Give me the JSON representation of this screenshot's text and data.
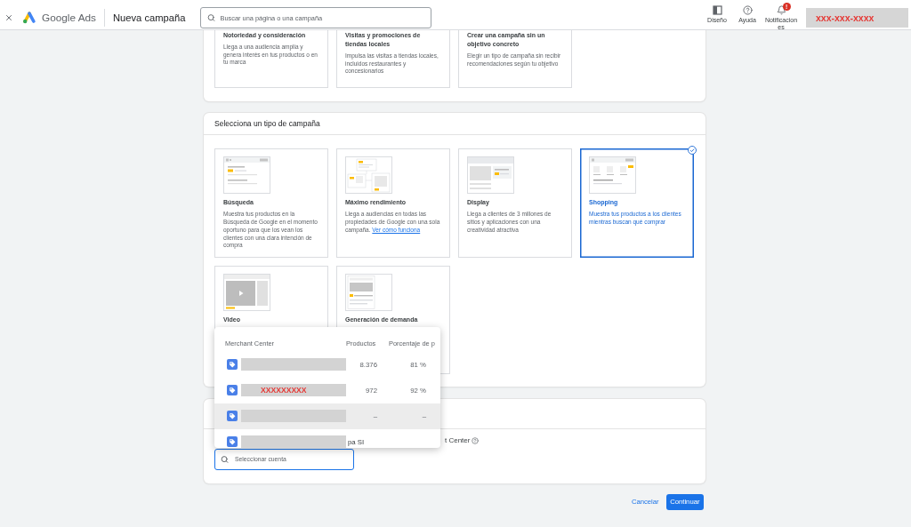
{
  "top_bar": {
    "product_name": "Google Ads",
    "page_title": "Nueva campaña",
    "search": {
      "placeholder": "Buscar una página o una campaña"
    },
    "actions": [
      {
        "kind": "appearance",
        "label": "Diseño"
      },
      {
        "kind": "help",
        "label": "Ayuda"
      },
      {
        "kind": "notifications",
        "label": "Notificaciones",
        "badge": "!"
      }
    ],
    "account": "xxx-xxx-xxxx"
  },
  "objectives": [
    {
      "title": "Notoriedad y consideración",
      "description": "Llega a una audiencia amplia y genera interés en tus productos o en tu marca",
      "selected": false
    },
    {
      "title": "Visitas y promociones de tiendas locales",
      "description": "Impulsa las visitas a tiendas locales, incluidos restaurantes y concesionarios",
      "selected": false
    },
    {
      "title": "Crear una campaña sin un objetivo concreto",
      "description": "Elegir un tipo de campaña sin recibir recomendaciones según tu objetivo",
      "selected": false
    }
  ],
  "campaign_types": {
    "title": "Selecciona un tipo de campaña",
    "types": [
      {
        "kind": "search",
        "title": "Búsqueda",
        "description": "Muestra tus productos en la Búsqueda de Google en el momento oportuno para que los vean los clientes con una clara intención de compra",
        "selected": false
      },
      {
        "kind": "performance",
        "title": "Máximo rendimiento",
        "description": "Llega a audiencias en todas las propiedades de Google con una sola campaña.",
        "link": "Ver cómo funciona",
        "selected": false
      },
      {
        "kind": "display",
        "title": "Display",
        "description": "Llega a clientes de 3 millones de sitios y aplicaciones con una creatividad atractiva",
        "selected": false
      },
      {
        "kind": "shopping",
        "title": "Shopping",
        "description": "Muestra tus productos a los clientes mientras buscan qué comprar",
        "selected": true
      },
      {
        "kind": "video",
        "title": "Video",
        "selected": false
      },
      {
        "kind": "demand",
        "title": "Generación de demanda",
        "selected": false
      }
    ]
  },
  "merchant_account": {
    "label": "t Center",
    "search": {
      "placeholder": "Seleccionar cuenta"
    },
    "dropdown": {
      "columns": [
        "Merchant Center",
        "Productos",
        "Porcentaje de p"
      ],
      "rows": [
        {
          "products": "8.376",
          "percentage": "81 %",
          "highlighted": false
        },
        {
          "redacted_label": "XXXXXXXXX",
          "products": "972",
          "percentage": "92 %",
          "highlighted": false
        },
        {
          "products": "–",
          "percentage": "–",
          "highlighted": true
        },
        {
          "name_tail": "pa SI",
          "highlighted": false
        }
      ]
    }
  },
  "footer": {
    "buttons": [
      {
        "kind": "text",
        "label": "Cancelar"
      },
      {
        "kind": "primary",
        "label": "Continuar"
      }
    ]
  }
}
